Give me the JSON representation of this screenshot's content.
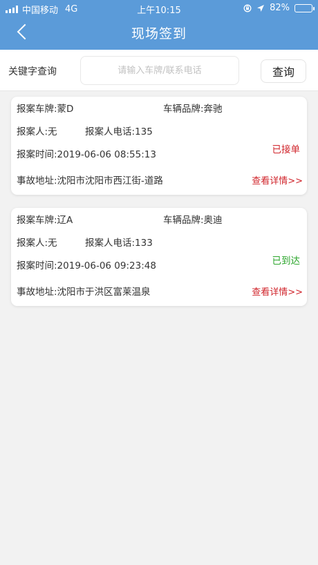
{
  "status_bar": {
    "carrier": "中国移动",
    "network": "4G",
    "time": "上午10:15",
    "battery_text": "82%",
    "battery_level": 0.82
  },
  "nav": {
    "title": "现场签到"
  },
  "search": {
    "label": "关键字查询",
    "placeholder": "请输入车牌/联系电话",
    "value": "",
    "button": "查询"
  },
  "colors": {
    "header": "#5b9bd9",
    "accepted": "#d0242b",
    "arrived": "#2aa52a",
    "detail_link": "#d0242b"
  },
  "records": [
    {
      "plate": "报案车牌:蒙D",
      "brand": "车辆品牌:奔驰",
      "reporter": "报案人:无",
      "phone": "报案人电话:135",
      "time": "报案时间:2019-06-06 08:55:13",
      "status": "已接单",
      "status_color": "#d0242b",
      "address": "事故地址:沈阳市沈阳市西江街-道路",
      "detail": "查看详情>>"
    },
    {
      "plate": "报案车牌:辽A",
      "brand": "车辆品牌:奥迪",
      "reporter": "报案人:无",
      "phone": "报案人电话:133",
      "time": "报案时间:2019-06-06 09:23:48",
      "status": "已到达",
      "status_color": "#2aa52a",
      "address": "事故地址:沈阳市于洪区富莱温泉",
      "detail": "查看详情>>"
    }
  ]
}
